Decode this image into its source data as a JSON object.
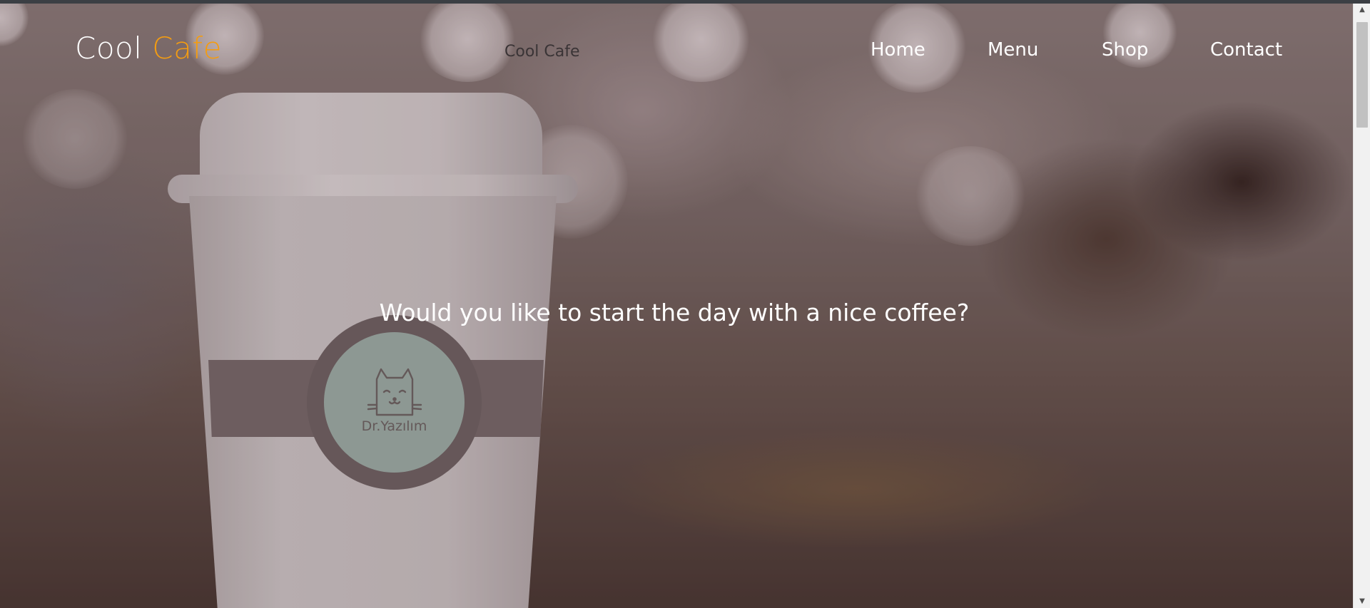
{
  "header": {
    "brand_primary": "Cool",
    "brand_accent": "Cafe",
    "center_title": "Cool Cafe"
  },
  "nav": {
    "items": [
      "Home",
      "Menu",
      "Shop",
      "Contact"
    ]
  },
  "hero": {
    "headline": "Would you like to start the day with a nice coffee?",
    "cup_badge_text": "Dr.Yazılım"
  },
  "colors": {
    "brand_accent": "#f39c12",
    "text_light": "#ffffff",
    "badge_green": "#9fb1ab"
  },
  "icons": [
    "cat-logo-icon",
    "scroll-up-arrow-icon",
    "scroll-down-arrow-icon"
  ]
}
